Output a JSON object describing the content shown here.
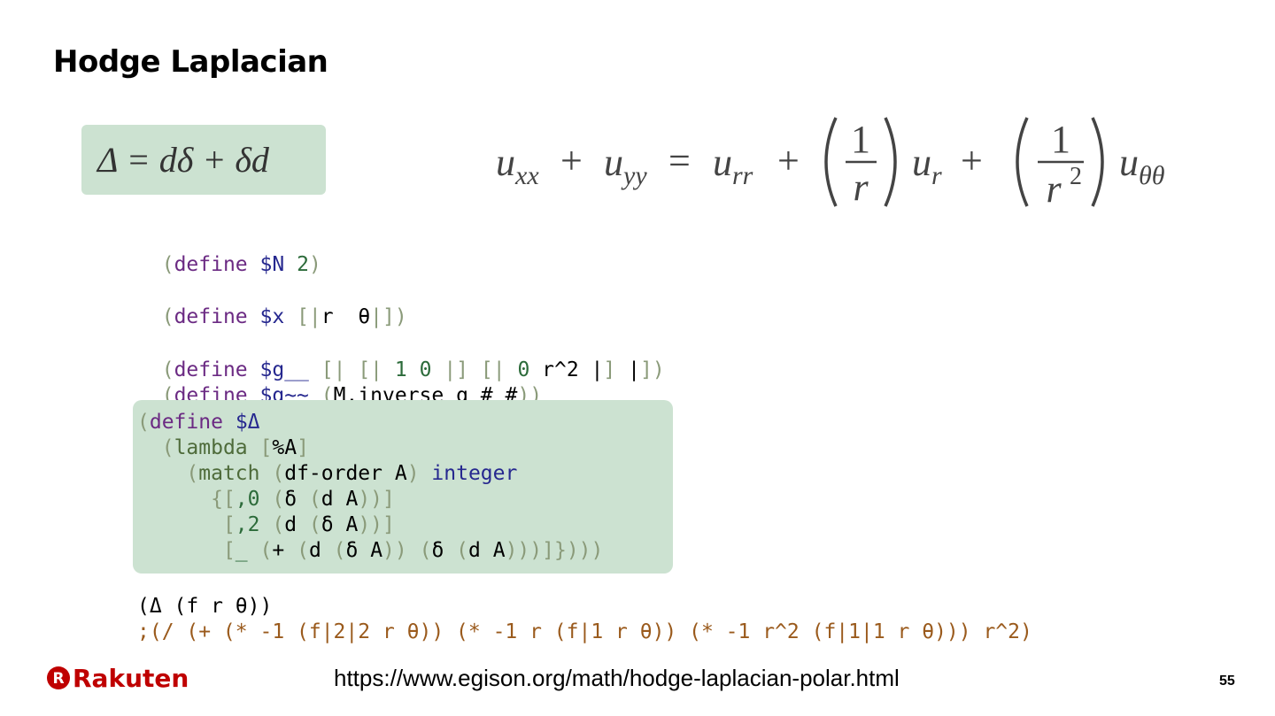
{
  "slide": {
    "title": "Hodge Laplacian",
    "formula": "Δ = dδ + δd",
    "pde": {
      "lhs1": "u",
      "lhs1_sub": "xx",
      "lhs2": "u",
      "lhs2_sub": "yy",
      "rhs1": "u",
      "rhs1_sub": "rr",
      "frac1_num": "1",
      "frac1_den": "r",
      "rhs2": "u",
      "rhs2_sub": "r",
      "frac2_num": "1",
      "frac2_den": "r",
      "frac2_den_sup": "2",
      "rhs3": "u",
      "rhs3_sub": "θθ",
      "plus": "+",
      "equals": "="
    },
    "code": {
      "line_N": [
        "(",
        "define",
        " ",
        "$N",
        " ",
        "2",
        ")"
      ],
      "line_x": [
        "(",
        "define",
        " ",
        "$x",
        " ",
        "[|",
        "r  θ",
        "|]",
        ")"
      ],
      "line_g1": [
        "(",
        "define",
        " ",
        "$g__",
        " ",
        "[|",
        " ",
        "[|",
        " ",
        "1",
        " ",
        "0",
        " ",
        "|]",
        " ",
        "[|",
        " ",
        "0",
        " ",
        "r^2 |",
        "]",
        " |",
        "]",
        ")"
      ],
      "line_g2": [
        "(",
        "define",
        " ",
        "$g~~",
        " ",
        "(",
        "M.inverse g_#_#",
        ")",
        ")"
      ],
      "delta_def": [
        "(define $Δ",
        "  (lambda [%A]",
        "    (match (df-order A) integer",
        "      {[,0 (δ (d A))]",
        "       [,2 (d (δ A))]",
        "       [_ (+ (d (δ A)) (δ (d A)))]})))"
      ],
      "call": "(Δ (f r θ))",
      "comment": ";(/ (+ (* -1 (f|2|2 r θ)) (* -1 r (f|1 r θ)) (* -1 r^2 (f|1|1 r θ))) r^2)"
    },
    "logo_text": "Rakuten",
    "url": "https://www.egison.org/math/hodge-laplacian-polar.html",
    "page_number": "55",
    "colors": {
      "highlight_box": "#cce2d1",
      "keyword": "#6b2a83",
      "variable": "#26288f",
      "number": "#2c6b3a",
      "paren": "#8a9a79",
      "comment": "#9a5a1c",
      "logo": "#bf0000"
    }
  }
}
